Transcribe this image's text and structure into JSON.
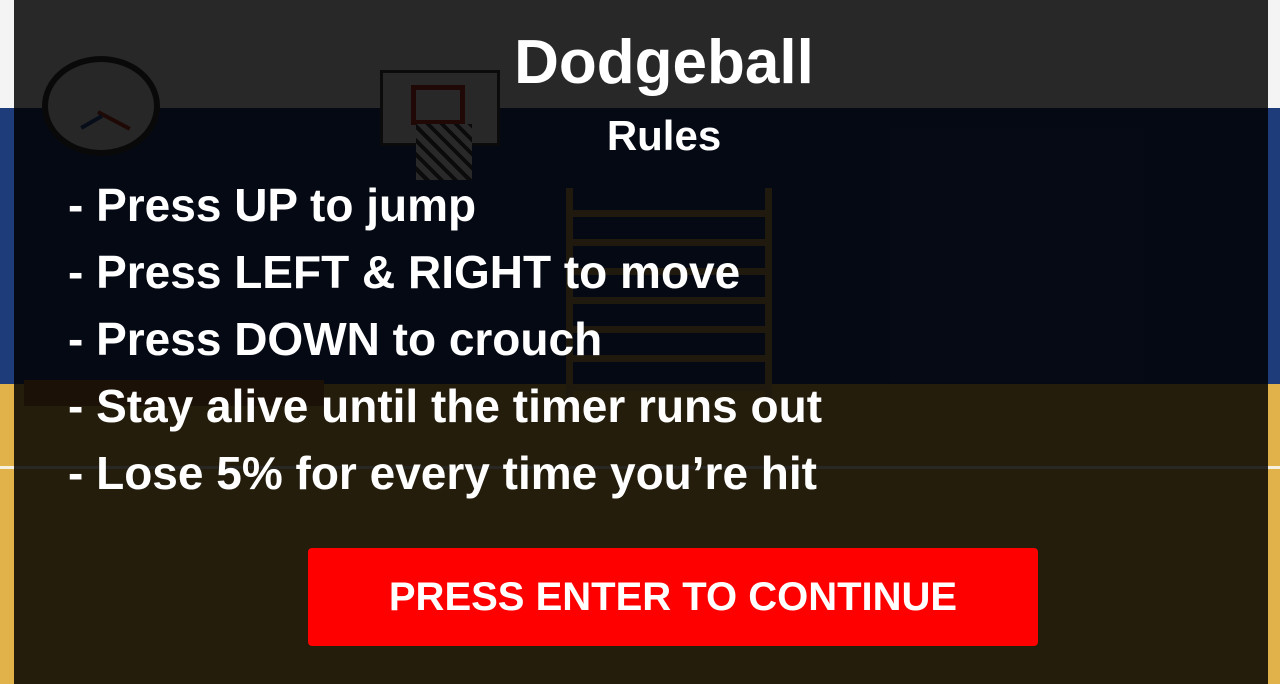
{
  "game": {
    "title": "Dodgeball",
    "subtitle": "Rules"
  },
  "rules": [
    "- Press UP to jump",
    "- Press LEFT & RIGHT to move",
    "- Press DOWN to crouch",
    "- Stay alive until the timer runs out",
    "- Lose 5% for every time you’re hit"
  ],
  "continue_button": {
    "label": "PRESS ENTER TO CONTINUE"
  },
  "colors": {
    "button": "#ff0000",
    "wall": "#1f3c7a",
    "floor": "#e1b24a",
    "overlay": "rgba(0,0,0,0.84)"
  },
  "background": {
    "items": [
      "wall-clock",
      "basketball-hoop",
      "climbing-wall-bars",
      "bench"
    ]
  }
}
